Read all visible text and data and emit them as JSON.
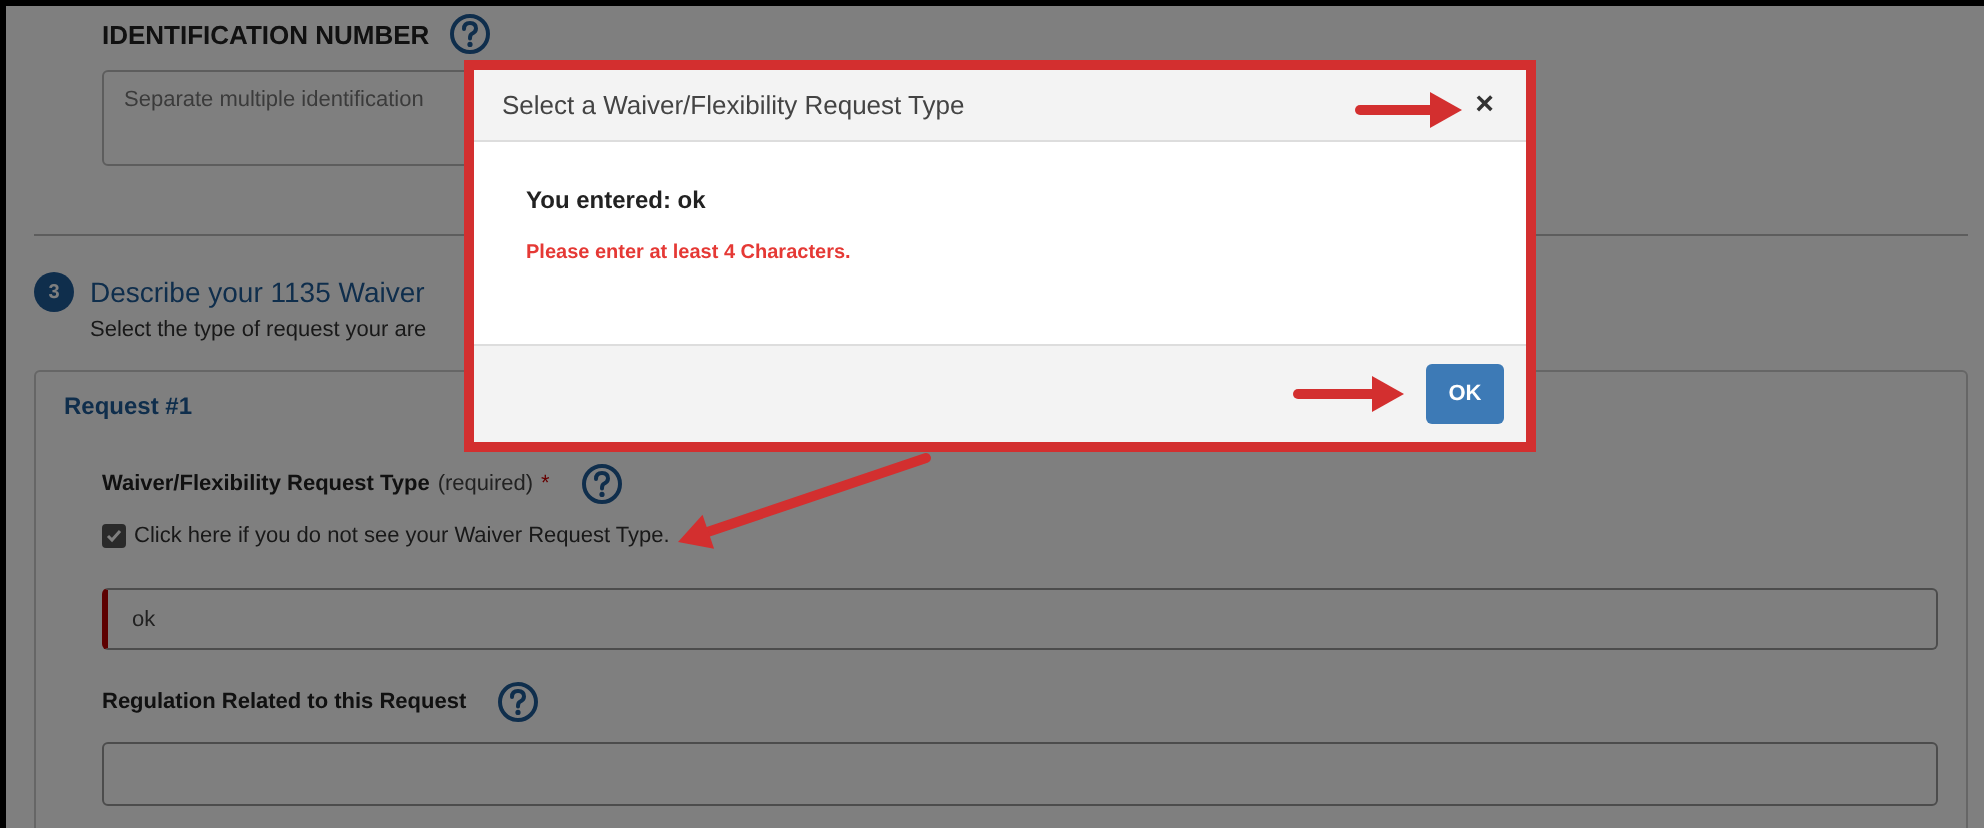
{
  "page": {
    "id_field": {
      "label": "IDENTIFICATION NUMBER",
      "placeholder": "Separate multiple identification"
    },
    "section": {
      "number": "3",
      "title": "Describe your 1135 Waiver",
      "subtitle": "Select the type of request your are"
    },
    "request": {
      "title": "Request #1",
      "type_field": {
        "label": "Waiver/Flexibility Request Type",
        "note": "(required)",
        "required_mark": "*",
        "checkbox": {
          "label": "Click here if you do not see your Waiver Request Type.",
          "checked": true
        },
        "value": "ok",
        "invalid": true
      },
      "regulation_field": {
        "label": "Regulation Related to this Request"
      }
    }
  },
  "dialog": {
    "title": "Select a Waiver/Flexibility Request Type",
    "close": "×",
    "message": "You entered: ok",
    "error": "Please enter at least 4 Characters.",
    "button": "OK"
  }
}
